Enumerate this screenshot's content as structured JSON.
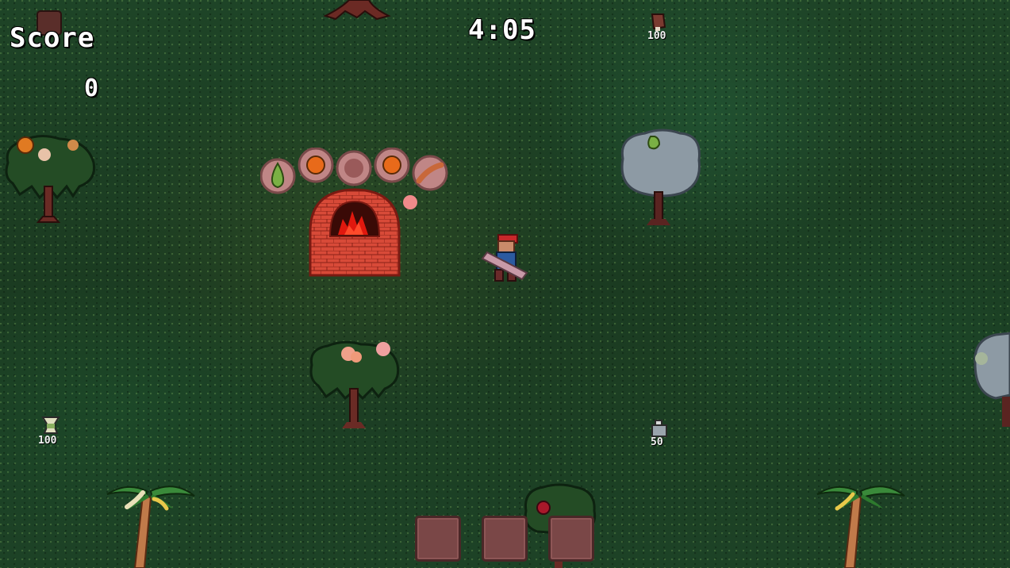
{
  "hud": {
    "score_label": "Score",
    "score_value": "0",
    "timer": "4:05"
  },
  "oven": {
    "recipe_icons": [
      "pear-icon",
      "orange-icon",
      "empty-plate-icon",
      "orange-icon",
      "sausage-icon"
    ],
    "floating_item": "peach-icon"
  },
  "markers": [
    {
      "icon": "meat-leg-icon",
      "label": "100"
    },
    {
      "icon": "trophy-icon",
      "label": "100"
    },
    {
      "icon": "bottle-icon",
      "label": "50"
    }
  ],
  "trees": [
    {
      "kind": "orange-tree"
    },
    {
      "kind": "pear-tree"
    },
    {
      "kind": "peach-tree"
    },
    {
      "kind": "apple-tree"
    },
    {
      "kind": "palm-tree"
    },
    {
      "kind": "palm-tree"
    }
  ],
  "inventory": {
    "slots": [
      "",
      "",
      ""
    ]
  },
  "colors": {
    "grass": "#1c3d22",
    "brick": "#d94a3a",
    "slot": "#7a4747",
    "hud_text": "#ffffff"
  }
}
